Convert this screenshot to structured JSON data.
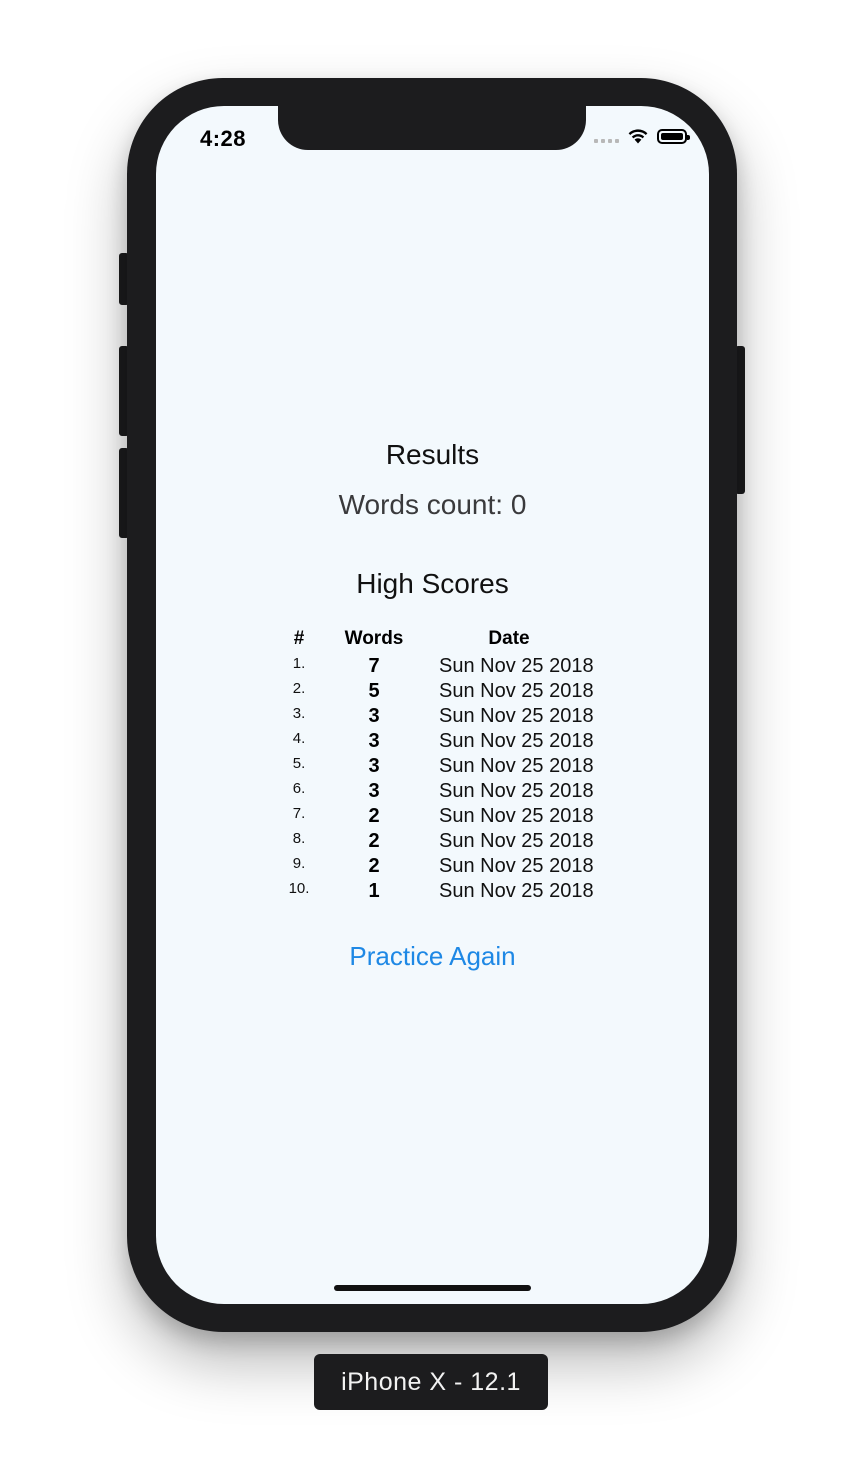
{
  "status_bar": {
    "time": "4:28",
    "wifi_icon": "wifi-icon",
    "battery_icon": "battery-icon"
  },
  "results": {
    "title": "Results",
    "words_count": "Words count: 0"
  },
  "high_scores": {
    "title": "High Scores",
    "columns": [
      "#",
      "Words",
      "Date"
    ],
    "rows": [
      {
        "rank": "1.",
        "words": "7",
        "date": "Sun Nov 25 2018"
      },
      {
        "rank": "2.",
        "words": "5",
        "date": "Sun Nov 25 2018"
      },
      {
        "rank": "3.",
        "words": "3",
        "date": "Sun Nov 25 2018"
      },
      {
        "rank": "4.",
        "words": "3",
        "date": "Sun Nov 25 2018"
      },
      {
        "rank": "5.",
        "words": "3",
        "date": "Sun Nov 25 2018"
      },
      {
        "rank": "6.",
        "words": "3",
        "date": "Sun Nov 25 2018"
      },
      {
        "rank": "7.",
        "words": "2",
        "date": "Sun Nov 25 2018"
      },
      {
        "rank": "8.",
        "words": "2",
        "date": "Sun Nov 25 2018"
      },
      {
        "rank": "9.",
        "words": "2",
        "date": "Sun Nov 25 2018"
      },
      {
        "rank": "10.",
        "words": "1",
        "date": "Sun Nov 25 2018"
      }
    ]
  },
  "actions": {
    "practice_again": "Practice Again"
  },
  "device_label": "iPhone X - 12.1",
  "colors": {
    "screen_background": "#f3f9fd",
    "link": "#1e88e5",
    "device_frame": "#1c1c1e"
  }
}
